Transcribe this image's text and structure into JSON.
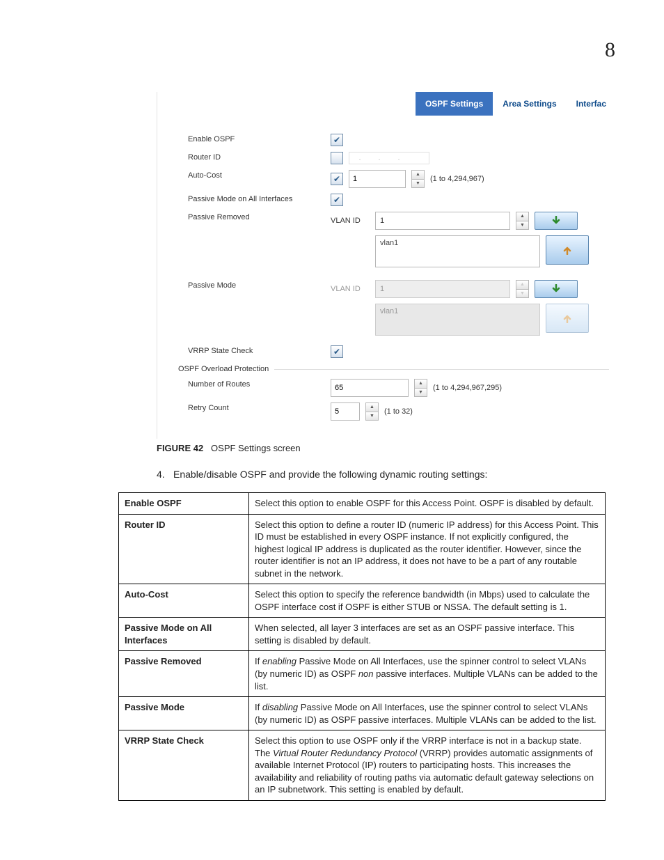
{
  "pageNumber": "8",
  "screenshot": {
    "tabs": [
      {
        "label": "OSPF Settings",
        "selected": true
      },
      {
        "label": "Area Settings",
        "selected": false
      },
      {
        "label": "Interfac",
        "selected": false
      }
    ],
    "rows": {
      "enableOspf": {
        "label": "Enable OSPF",
        "checked": true
      },
      "routerId": {
        "label": "Router ID",
        "checked": false,
        "value": ""
      },
      "autoCost": {
        "label": "Auto-Cost",
        "checked": true,
        "value": "1",
        "hint": "(1 to 4,294,967)"
      },
      "passiveAll": {
        "label": "Passive Mode on All Interfaces",
        "checked": true
      },
      "passiveRemoved": {
        "label": "Passive Removed",
        "vlanLabel": "VLAN ID",
        "vlanValue": "1",
        "listValue": "vlan1"
      },
      "passiveMode": {
        "label": "Passive Mode",
        "vlanLabel": "VLAN ID",
        "vlanValue": "1",
        "listValue": "vlan1"
      },
      "vrrp": {
        "label": "VRRP State Check",
        "checked": true
      }
    },
    "group": {
      "title": "OSPF Overload Protection",
      "numRoutes": {
        "label": "Number of Routes",
        "value": "65",
        "hint": "(1 to 4,294,967,295)"
      },
      "retry": {
        "label": "Retry Count",
        "value": "5",
        "hint": "(1 to 32)"
      }
    }
  },
  "captionBold": "FIGURE 42",
  "captionText": "OSPF Settings screen",
  "step": {
    "num": "4.",
    "text": "Enable/disable OSPF and provide the following dynamic routing settings:"
  },
  "table": [
    {
      "term": "Enable OSPF",
      "def": [
        {
          "t": "Select this option to enable OSPF for this Access Point. OSPF is disabled by default."
        }
      ]
    },
    {
      "term": "Router ID",
      "def": [
        {
          "t": "Select this option to define a router ID (numeric IP address) for this Access Point. This ID must be established in every OSPF instance. If not explicitly configured, the highest logical IP address is duplicated as the router identifier. However, since the router identifier is not an IP address, it does not have to be a part of any routable subnet in the network."
        }
      ]
    },
    {
      "term": "Auto-Cost",
      "def": [
        {
          "t": "Select this option to specify the reference bandwidth (in Mbps) used to calculate the OSPF interface cost if OSPF is either STUB or NSSA. The default setting is 1."
        }
      ]
    },
    {
      "term": "Passive Mode on All Interfaces",
      "def": [
        {
          "t": "When selected, all layer 3 interfaces are set as an OSPF passive interface. This setting is disabled by default."
        }
      ]
    },
    {
      "term": "Passive Removed",
      "def": [
        {
          "t": "If "
        },
        {
          "i": "enabling"
        },
        {
          "t": " Passive Mode on All Interfaces, use the spinner control to select VLANs (by numeric ID) as OSPF "
        },
        {
          "i": "non"
        },
        {
          "t": " passive interfaces. Multiple VLANs can be added to the list."
        }
      ]
    },
    {
      "term": "Passive Mode",
      "def": [
        {
          "t": "If "
        },
        {
          "i": "disabling"
        },
        {
          "t": " Passive Mode on All Interfaces, use the spinner control to select VLANs (by numeric ID) as OSPF passive interfaces. Multiple VLANs can be added to the list."
        }
      ]
    },
    {
      "term": "VRRP State Check",
      "def": [
        {
          "t": "Select this option to use OSPF only if the VRRP interface is not in a backup state. The "
        },
        {
          "i": "Virtual Router Redundancy Protocol"
        },
        {
          "t": " (VRRP) provides automatic assignments of available Internet Protocol (IP) routers to participating hosts. This increases the availability and reliability of routing paths via automatic default gateway selections on an IP subnetwork. This setting is enabled by default."
        }
      ]
    }
  ]
}
